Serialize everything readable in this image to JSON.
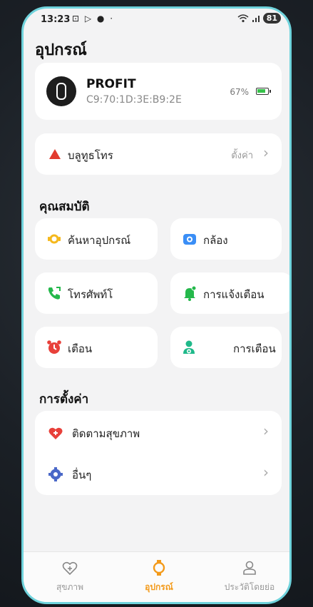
{
  "status_bar": {
    "time": "13:23",
    "battery": "81"
  },
  "page_title": "อุปกรณ์",
  "device": {
    "name": "PROFIT",
    "mac": "C9:70:1D:3E:B9:2E",
    "battery_percent": "67%"
  },
  "bluetooth": {
    "label": "บลูทูธโทร",
    "setting": "ตั้งค่า"
  },
  "features": {
    "title": "คุณสมบัติ",
    "items": [
      {
        "label": "ค้นหาอุปกรณ์",
        "icon": "find-watch-icon",
        "color": "#f5b81c"
      },
      {
        "label": "กล้อง",
        "icon": "camera-icon",
        "color": "#3a8ef6"
      },
      {
        "label": "โทรศัพท์โ",
        "icon": "phone-icon",
        "color": "#24b84b"
      },
      {
        "label": "การแจ้งเตือน",
        "icon": "bell-icon",
        "color": "#24b84b"
      },
      {
        "label": "เตือน",
        "icon": "alarm-icon",
        "color": "#e8403a"
      },
      {
        "label": "การเตือน",
        "icon": "person-add-icon",
        "color": "#1fb98a"
      }
    ]
  },
  "settings": {
    "title": "การตั้งค่า",
    "items": [
      {
        "label": "ติดตามสุขภาพ",
        "icon": "heart-icon",
        "color": "#e8403a"
      },
      {
        "label": "อื่นๆ",
        "icon": "gear-icon",
        "color": "#4a68c8"
      }
    ]
  },
  "tabs": [
    {
      "label": "สุขภาพ",
      "icon": "heart-plus-icon",
      "active": false
    },
    {
      "label": "อุปกรณ์",
      "icon": "watch-icon",
      "active": true,
      "color": "#f39a1a"
    },
    {
      "label": "ประวัติโดยย่อ",
      "icon": "profile-icon",
      "active": false
    }
  ]
}
